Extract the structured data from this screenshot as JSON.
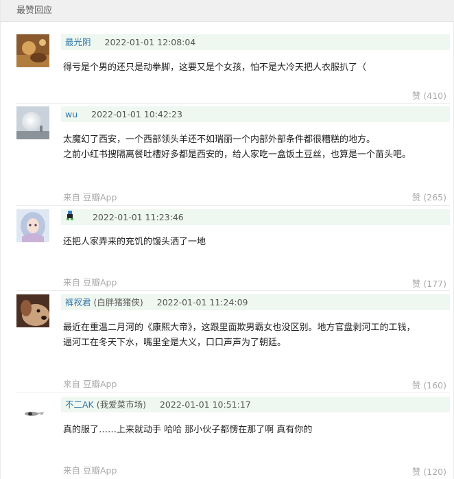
{
  "section": {
    "title": "最赞回应"
  },
  "comments": [
    {
      "author": "最光阴",
      "subname": "",
      "time": "2022-01-01 12:08:04",
      "lines": [
        "得亏是个男的还只是动拳脚，这要又是个女孩，怕不是大冷天把人衣服扒了（"
      ],
      "source": "",
      "votes": "赞 (410)"
    },
    {
      "author": "wu",
      "subname": "",
      "time": "2022-01-01 10:42:23",
      "lines": [
        "太魔幻了西安，一个西部领头羊还不如瑞丽一个内部外部条件都很糟糕的地方。",
        "之前小红书搜隔离餐吐槽好多都是西安的，给人家吃一盒饭土豆丝，也算是一个苗头吧。"
      ],
      "source": "来自 豆瓣App",
      "votes": "赞 (265)"
    },
    {
      "author": "",
      "subname": "",
      "time": "2022-01-01 11:23:46",
      "lines": [
        "还把人家弄来的充饥的馒头洒了一地"
      ],
      "source": "来自 豆瓣App",
      "votes": "赞 (177)"
    },
    {
      "author": "裤衩君",
      "subname": "(白胖猪猪侠)",
      "time": "2022-01-01 11:24:09",
      "lines": [
        "最近在重温二月河的《康熙大帝》，这跟里面欺男霸女也没区别。地方官盘剥河工的工钱，",
        "逼河工在冬天下水，嘴里全是大义，口口声声为了朝廷。"
      ],
      "source": "来自 豆瓣App",
      "votes": "赞 (160)"
    },
    {
      "author": "不二AK",
      "subname": "(我爱菜市场)",
      "time": "2022-01-01 10:51:17",
      "lines": [
        "真的服了……上来就动手 哈哈 那小伙子都愣在那了啊 真有你的"
      ],
      "source": "来自 豆瓣App",
      "votes": "赞 (120)"
    }
  ]
}
